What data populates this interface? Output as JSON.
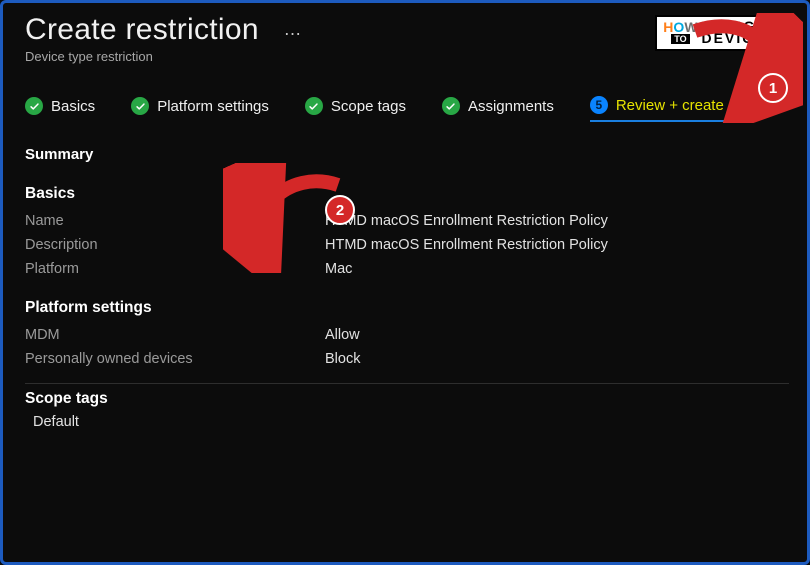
{
  "header": {
    "title": "Create restriction",
    "subtitle": "Device type restriction",
    "more_icon": "…"
  },
  "logo": {
    "part_how": "HOW",
    "part_to": "TO",
    "part_line1": "MANAGE",
    "part_line2": "DEVICES"
  },
  "tabs": [
    {
      "label": "Basics"
    },
    {
      "label": "Platform settings"
    },
    {
      "label": "Scope tags"
    },
    {
      "label": "Assignments"
    },
    {
      "label": "Review + create"
    }
  ],
  "summary_label": "Summary",
  "sections": {
    "basics": {
      "title": "Basics",
      "rows": [
        {
          "key": "Name",
          "value": "HTMD macOS Enrollment Restriction Policy"
        },
        {
          "key": "Description",
          "value": "HTMD macOS Enrollment Restriction Policy"
        },
        {
          "key": "Platform",
          "value": "Mac"
        }
      ]
    },
    "platform_settings": {
      "title": "Platform settings",
      "rows": [
        {
          "key": "MDM",
          "value": "Allow"
        },
        {
          "key": "Personally owned devices",
          "value": "Block"
        }
      ]
    },
    "scope_tags": {
      "title": "Scope tags",
      "value": "Default"
    }
  },
  "annotations": {
    "badge1": "1",
    "badge2": "2"
  }
}
